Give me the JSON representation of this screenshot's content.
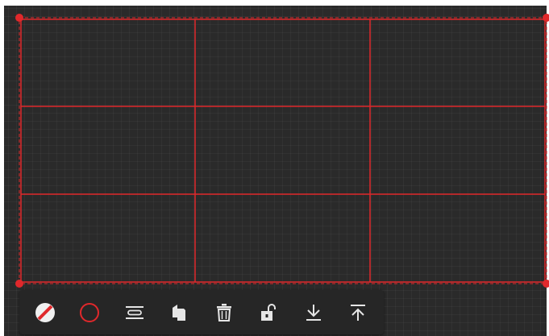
{
  "canvas": {
    "background": "#2a2a2a",
    "grid_color": "#3a3a3a"
  },
  "shape": {
    "type": "table-grid",
    "rows": 3,
    "columns": 3,
    "stroke_color": "#e0282b",
    "handle_color": "#e0282b"
  },
  "toolbar": {
    "background": "#262626",
    "icon_color": "#e6e6e6",
    "tools": [
      {
        "name": "fill-none",
        "icon": "no-fill-icon"
      },
      {
        "name": "stroke-color",
        "icon": "circle-outline-icon"
      },
      {
        "name": "stroke-style",
        "icon": "line-style-icon"
      },
      {
        "name": "duplicate",
        "icon": "copy-icon"
      },
      {
        "name": "delete",
        "icon": "trash-icon"
      },
      {
        "name": "lock",
        "icon": "unlock-icon"
      },
      {
        "name": "send-backward",
        "icon": "send-to-back-icon"
      },
      {
        "name": "bring-forward",
        "icon": "bring-to-front-icon"
      }
    ]
  }
}
